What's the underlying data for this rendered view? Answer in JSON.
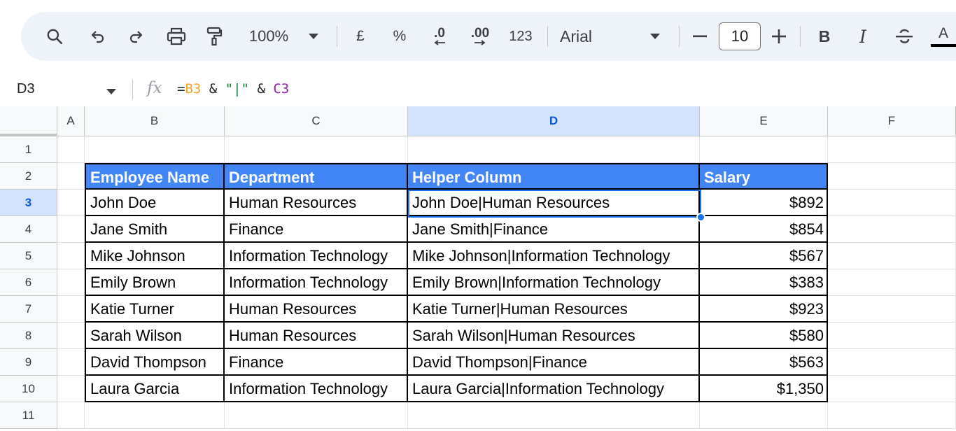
{
  "toolbar": {
    "zoom": "100%",
    "currency_symbol": "£",
    "percent_symbol": "%",
    "decrease_decimal": ".0",
    "increase_decimal": ".00",
    "number_format": "123",
    "font_family": "Arial",
    "font_size": "10",
    "bold": "B",
    "italic": "I",
    "text_color": "A",
    "icons": [
      "search-icon",
      "undo-icon",
      "redo-icon",
      "print-icon",
      "paint-format-icon",
      "zoom-dropdown-icon",
      "font-dropdown-icon",
      "minus-icon",
      "plus-icon",
      "strikethrough-icon"
    ]
  },
  "formula_bar": {
    "cell_ref": "D3",
    "fx": "fx",
    "formula_parts": [
      "=",
      "B3",
      " & ",
      "\"|\"",
      " & ",
      "C3"
    ]
  },
  "columns": [
    "A",
    "B",
    "C",
    "D",
    "E",
    "F"
  ],
  "selected_column": "D",
  "rows": [
    "1",
    "2",
    "3",
    "4",
    "5",
    "6",
    "7",
    "8",
    "9",
    "10",
    "11"
  ],
  "selected_row": "3",
  "table": {
    "headers": [
      "Employee Name",
      "Department",
      "Helper Column",
      "Salary"
    ],
    "rows": [
      [
        "John Doe",
        "Human Resources",
        "John Doe|Human Resources",
        "$892"
      ],
      [
        "Jane Smith",
        "Finance",
        "Jane Smith|Finance",
        "$854"
      ],
      [
        "Mike Johnson",
        "Information Technology",
        "Mike Johnson|Information Technology",
        "$567"
      ],
      [
        "Emily Brown",
        "Information Technology",
        "Emily Brown|Information Technology",
        "$383"
      ],
      [
        "Katie Turner",
        "Human Resources",
        "Katie Turner|Human Resources",
        "$923"
      ],
      [
        "Sarah Wilson",
        "Human Resources",
        "Sarah Wilson|Human Resources",
        "$580"
      ],
      [
        "David Thompson",
        "Finance",
        "David Thompson|Finance",
        "$563"
      ],
      [
        "Laura Garcia",
        "Information Technology",
        "Laura Garcia|Information Technology",
        "$1,350"
      ]
    ]
  },
  "colors": {
    "header_fill": "#4285f4",
    "selection": "#1a73e8",
    "selected_header": "#d3e3fd",
    "toolbar_bg": "#eef2f9"
  }
}
